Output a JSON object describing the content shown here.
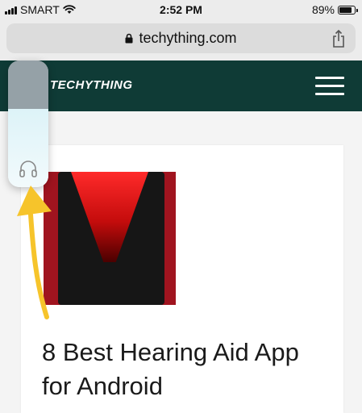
{
  "status_bar": {
    "carrier": "SMART",
    "time": "2:52 PM",
    "battery_percent": "89%",
    "battery_level": 0.89,
    "signal_bars": 4,
    "wifi_icon": "wifi-icon"
  },
  "address_bar": {
    "url": "techything.com",
    "lock_icon": "lock-icon",
    "share_icon": "share-icon"
  },
  "site_header": {
    "logo": "TECHYTHING",
    "menu_icon": "hamburger-menu-icon",
    "background": "#0f3b36"
  },
  "article": {
    "title": "8 Best Hearing Aid App for Android"
  },
  "overlay": {
    "icon": "headphone-icon",
    "level": 0.62,
    "arrow_color": "#f6c42b"
  }
}
